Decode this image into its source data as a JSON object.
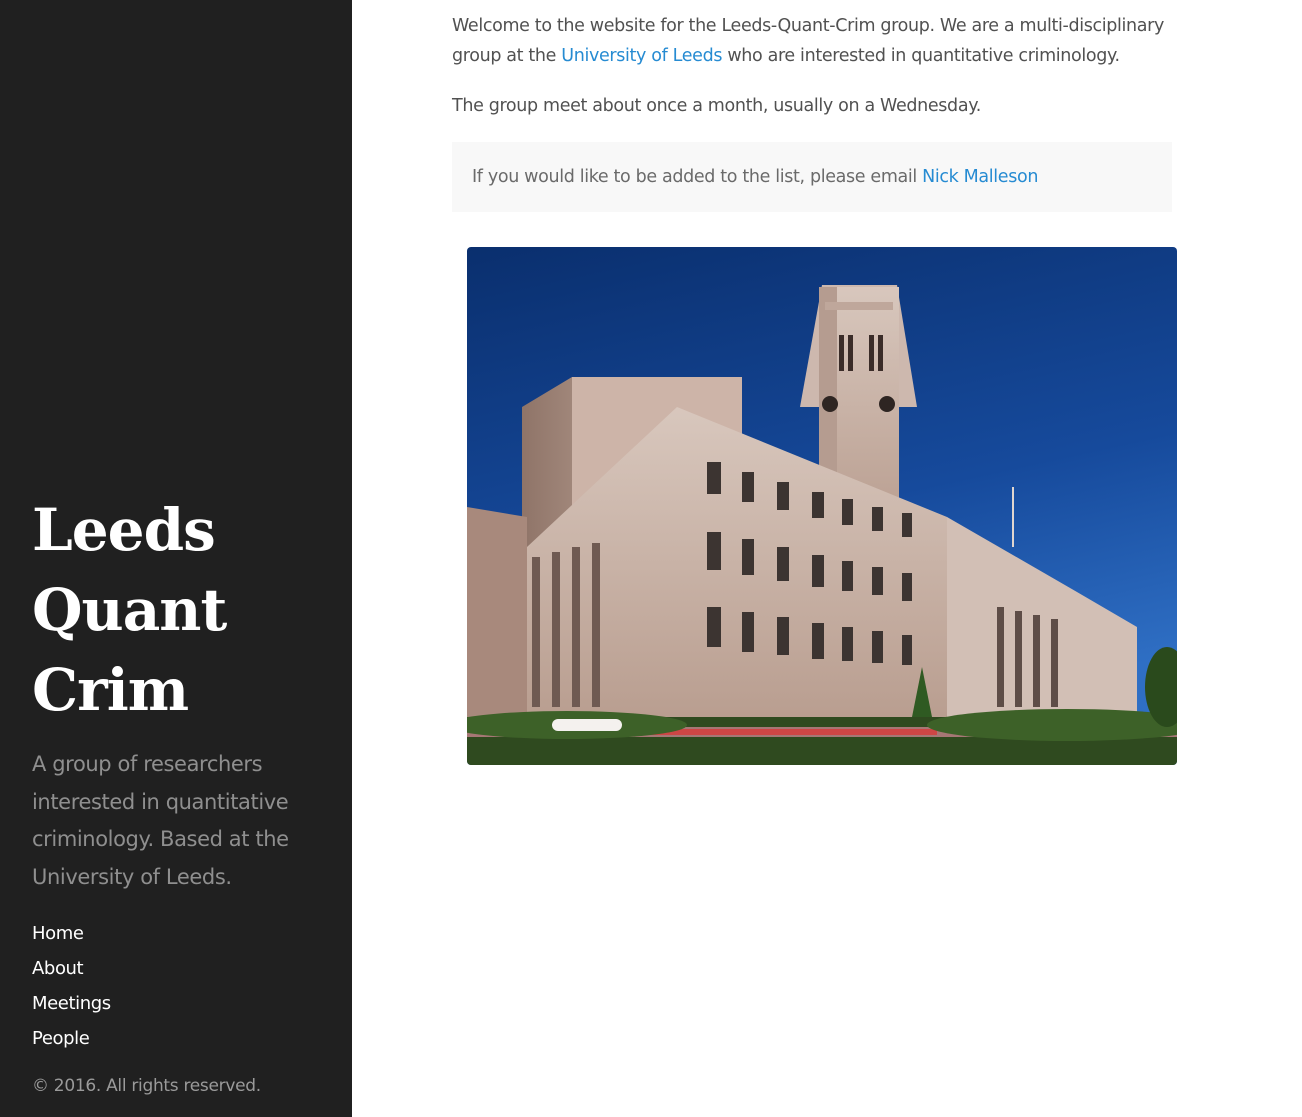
{
  "sidebar": {
    "title_lines": [
      "Leeds",
      "Quant",
      "Crim"
    ],
    "lead": "A group of researchers interested in quantitative criminology. Based at the University of Leeds.",
    "nav": [
      {
        "label": "Home"
      },
      {
        "label": "About"
      },
      {
        "label": "Meetings"
      },
      {
        "label": "People"
      }
    ],
    "copyright": "© 2016. All rights reserved."
  },
  "content": {
    "intro_before": "Welcome to the website for the Leeds-Quant-Crim group. We are a multi-disciplinary group at the ",
    "intro_link": "University of Leeds",
    "intro_after": " who are interested in quantitative criminology.",
    "meeting_text": "The group meet about once a month, usually on a Wednesday.",
    "notice_before": "If you would like to be added to the list, please email ",
    "notice_link": "Nick Malleson"
  },
  "colors": {
    "sidebar_bg": "#202020",
    "link": "#268bd2",
    "notice_bg": "#f8f8f8"
  }
}
